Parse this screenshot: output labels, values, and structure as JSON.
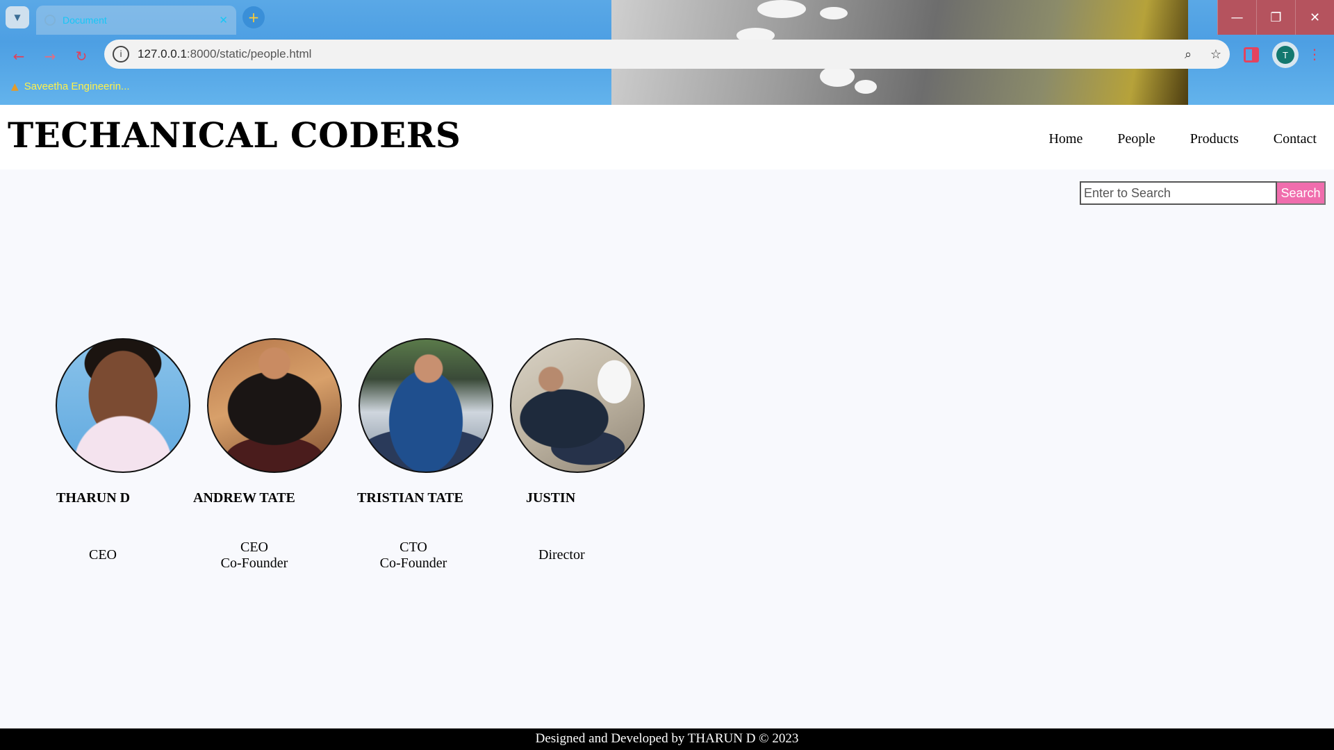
{
  "browser": {
    "tab_title": "Document",
    "tab_close": "✕",
    "new_tab": "+",
    "url_host": "127.0.0.1",
    "url_path": ":8000/static/people.html",
    "bookmark_label": "Saveetha Engineerin...",
    "avatar_initial": "T",
    "window_controls": [
      "—",
      "❐",
      "✕"
    ]
  },
  "site": {
    "title": "TECHANICAL CODERS",
    "nav": [
      "Home",
      "People",
      "Products",
      "Contact"
    ]
  },
  "search": {
    "placeholder": "Enter to Search",
    "button_label": "Search"
  },
  "people": [
    {
      "name": "THARUN D",
      "role_line1": "CEO",
      "role_line2": ""
    },
    {
      "name": "ANDREW TATE",
      "role_line1": "CEO",
      "role_line2": "Co-Founder"
    },
    {
      "name": "TRISTIAN TATE",
      "role_line1": "CTO",
      "role_line2": "Co-Founder"
    },
    {
      "name": "JUSTIN",
      "role_line1": "Director",
      "role_line2": ""
    }
  ],
  "footer": {
    "text": "Designed and Developed by THARUN D © 2023"
  },
  "colors": {
    "search_button": "#f06dad",
    "tab_text": "#19c6f5",
    "bookmark_text": "#fff14a",
    "footer_bg": "#000000"
  }
}
